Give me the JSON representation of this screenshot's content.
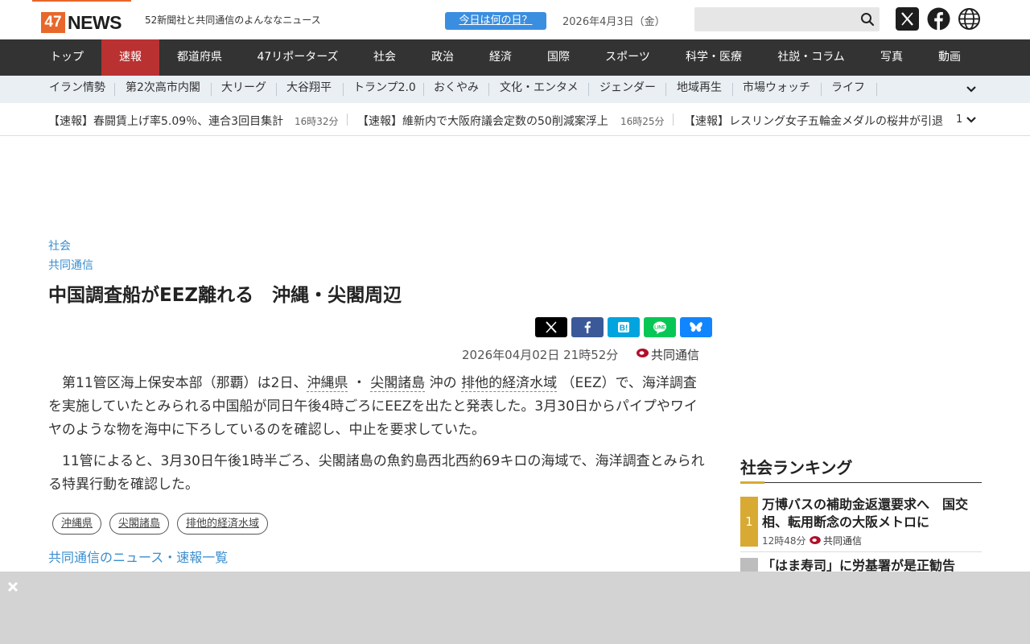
{
  "header": {
    "logo_number": "47",
    "logo_word": "NEWS",
    "tagline": "52新聞社と共同通信のよんななニュース",
    "today_button": "今日は何の日？",
    "date": "2026年4月3日（金）",
    "search_placeholder": ""
  },
  "main_nav": [
    "トップ",
    "速報",
    "都道府県",
    "47リポーターズ",
    "社会",
    "政治",
    "経済",
    "国際",
    "スポーツ",
    "科学・医療",
    "社説・コラム",
    "写真",
    "動画"
  ],
  "main_nav_active": "速報",
  "sub_nav": [
    "イラン情勢",
    "第2次高市内閣",
    "大リーグ",
    "大谷翔平",
    "トランプ2.0",
    "おくやみ",
    "文化・エンタメ",
    "ジェンダー",
    "地域再生",
    "市場ウォッチ",
    "ライフ"
  ],
  "ticker": {
    "items": [
      {
        "text": "【速報】春闘賃上げ率5.09％、連合3回目集計",
        "time": "16時32分"
      },
      {
        "text": "【速報】維新内で大阪府議会定数の50削減案浮上",
        "time": "16時25分"
      },
      {
        "text": "【速報】レスリング女子五輪金メダルの桜井が引退",
        "time": ""
      }
    ],
    "page": "1"
  },
  "article": {
    "category": "社会",
    "source_link": "共同通信",
    "title": "中国調査船がEEZ離れる　沖縄・尖閣周辺",
    "date": "2026年04月02日 21時52分",
    "source": "共同通信",
    "p1": {
      "a": "　第11管区海上保安本部（那覇）は2日、",
      "kw1": "沖縄県",
      "b": " ・ ",
      "kw2": "尖閣諸島",
      "c": " 沖の ",
      "kw3": "排他的経済水域",
      "d": " （EEZ）で、海洋調査を実施していたとみられる中国船が同日午後4時ごろにEEZを出たと発表した。3月30日からパイプやワイヤのような物を海中に下ろしているのを確認し、中止を要求していた。"
    },
    "p2": "　11管によると、3月30日午後1時半ごろ、尖閣諸島の魚釣島西北西約69キロの海域で、海洋調査とみられる特異行動を確認した。",
    "tags": [
      "沖縄県",
      "尖閣諸島",
      "排他的経済水域"
    ],
    "list_link": "共同通信のニュース・速報一覧"
  },
  "ranking": {
    "title": "社会ランキング",
    "items": [
      {
        "rank": "1",
        "title": "万博バスの補助金返還要求へ　国交相、転用断念の大阪メトロに",
        "time": "12時48分",
        "source": "共同通信"
      },
      {
        "rank": "",
        "title": "「はま寿司」に労基署が是正勧告",
        "time": "",
        "source": ""
      }
    ]
  },
  "colors": {
    "brand_orange": "#e8672a",
    "nav_bg": "#333333",
    "nav_active": "#b93131",
    "link_blue": "#3a8ecf",
    "rank_gold": "#d8aa33"
  },
  "icons": [
    "search-icon",
    "x-icon",
    "facebook-icon",
    "globe-icon",
    "chevron-down-icon",
    "close-icon",
    "kyodo-icon"
  ]
}
